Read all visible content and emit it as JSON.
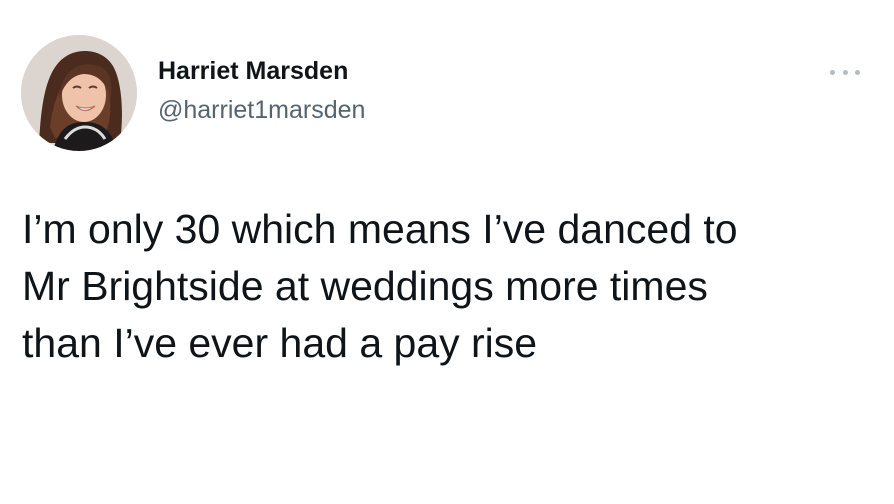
{
  "author": {
    "display_name": "Harriet Marsden",
    "handle": "@harriet1marsden"
  },
  "icons": {
    "more": "more-options-icon"
  },
  "tweet": {
    "lines": [
      "I’m only 30 which means I’ve danced to",
      "Mr Brightside at weddings more times",
      "than I’ve ever had a pay rise"
    ]
  },
  "colors": {
    "primary_text": "#0f1419",
    "secondary_text": "#536471",
    "background": "#ffffff"
  }
}
